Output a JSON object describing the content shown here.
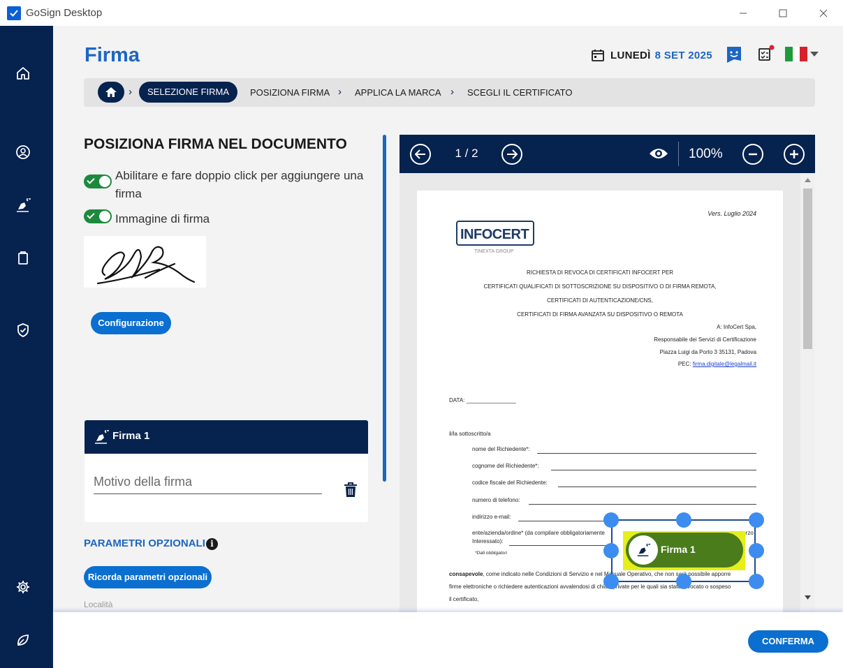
{
  "window": {
    "title": "GoSign Desktop"
  },
  "header": {
    "page_title": "Firma",
    "date_day": "LUNEDÌ",
    "date_num": "8 SET 2025"
  },
  "breadcrumb": {
    "items": [
      "SELEZIONE FIRMA",
      "POSIZIONA FIRMA",
      "APPLICA LA MARCA",
      "SCEGLI IL CERTIFICATO"
    ]
  },
  "left": {
    "title": "POSIZIONA FIRMA NEL DOCUMENTO",
    "option1_line1": "Abilitare e fare doppio click per aggiungere una",
    "option1_line2": "firma",
    "option2": "Immagine di firma",
    "config_button": "Configurazione",
    "card_title": "Firma 1",
    "motivo_placeholder": "Motivo della firma",
    "param_title": "PARAMETRI OPZIONALI",
    "param_button": "Ricorda parametri opzionali",
    "faded_text": "Località"
  },
  "viewer": {
    "page_indicator": "1 / 2",
    "zoom": "100%"
  },
  "document": {
    "version": "Vers.  Luglio 2024",
    "logo_main": "INFOCERT",
    "logo_sub": "TINEXTA GROUP",
    "heading": [
      "RICHIESTA DI REVOCA DI CERTIFICATI INFOCERT PER",
      "CERTIFICATI QUALIFICATI DI SOTTOSCRIZIONE SU DISPOSITIVO O DI FIRMA REMOTA,",
      "CERTIFICATI DI AUTENTICAZIONE/CNS,",
      "CERTIFICATI DI FIRMA AVANZATA SU DISPOSITIVO O REMOTA"
    ],
    "address": [
      "A: InfoCert Spa,",
      "Responsabile dei Servizi di Certificazione",
      "Piazza Luigi da Porto 3 35131, Padova"
    ],
    "pec_label": "PEC:",
    "pec_link": "firma.digitale@legalmail.it",
    "data_label": "DATA: ________________",
    "sottoscritto": "il/la sottoscritto/a",
    "fields": [
      "nome del Richiedente*:",
      "cognome  del  Richiedente*:",
      "codice fiscale  del  Richiedente:",
      "numero  di  telefono:",
      "indirizzo e-mail:"
    ],
    "ente_line1": "ente/azienda/ordine*  (da  compilare  obbligatoriamente",
    "ente_tail": "terzo",
    "ente_line2": "Interessato):",
    "dati_note": "*Dati obbligatori",
    "consapevole_bold": "consapevole",
    "consapevole_rest": ", come indicato nelle Condizioni di Servizio e nel Manuale Operativo, che non sarà possibile apporre",
    "line2": "firme elettroniche o richiedere autenticazioni avvalendosi di chiavi private per le quali sia stato revocato o sospeso",
    "line3": "il certificato,"
  },
  "signature_field": {
    "label": "Firma 1"
  },
  "footer": {
    "confirm_button": "CONFERMA"
  },
  "colors": {
    "brand_navy": "#06224e",
    "accent_blue": "#1c66c4",
    "button_blue": "#0a6fd0",
    "toggle_green": "#1c8a3d",
    "sig_green": "#4a7c1c"
  }
}
